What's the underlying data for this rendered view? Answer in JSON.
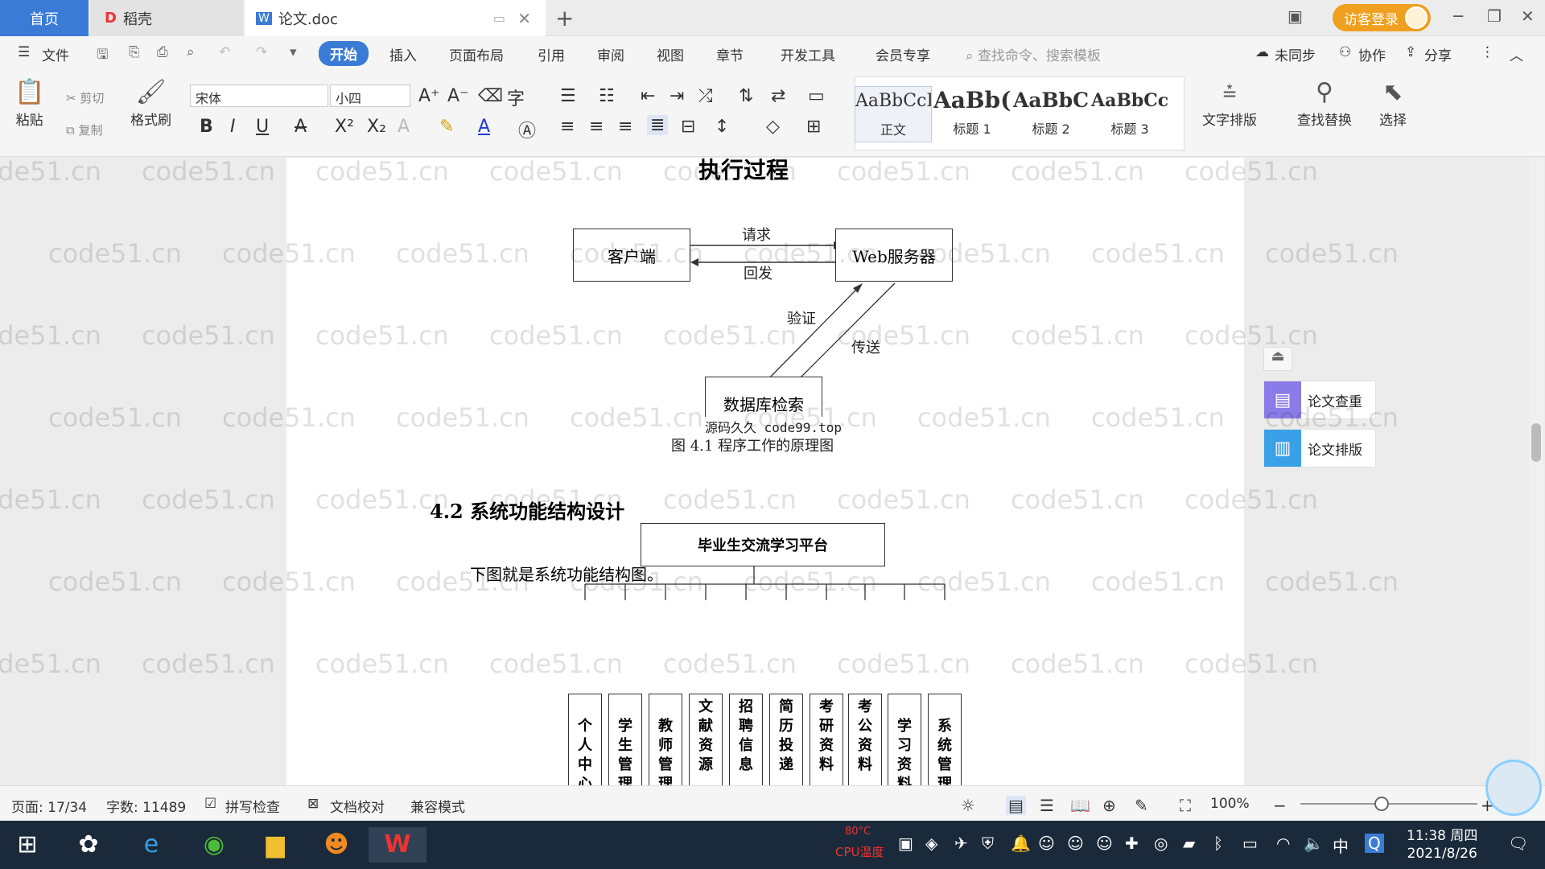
{
  "tabs": {
    "home": "首页",
    "daoke": "稻壳",
    "doc": "论文.doc",
    "add": "+"
  },
  "window": {
    "login": "访客登录",
    "min": "─",
    "restore": "❐",
    "close": "✕",
    "layout": "▣"
  },
  "menu": {
    "file": "文件",
    "start": "开始",
    "insert": "插入",
    "layout": "页面布局",
    "ref": "引用",
    "review": "审阅",
    "view": "视图",
    "chapter": "章节",
    "devtools": "开发工具",
    "member": "会员专享",
    "search": "查找命令、搜索模板",
    "unsync": "未同步",
    "collab": "协作",
    "share": "分享"
  },
  "ribbon": {
    "paste": "粘贴",
    "cut": "剪切",
    "copy": "复制",
    "format_painter": "格式刷",
    "font": "宋体",
    "size": "小四",
    "styles": [
      {
        "sample": "AaBbCcI",
        "name": "正文"
      },
      {
        "sample": "AaBb(",
        "name": "标题 1"
      },
      {
        "sample": "AaBbC",
        "name": "标题 2"
      },
      {
        "sample": "AaBbCcl",
        "name": "标题 3"
      }
    ],
    "text_layout": "文字排版",
    "find_replace": "查找替换",
    "select": "选择"
  },
  "doc": {
    "top_heading": "执行过程",
    "diagram1": {
      "client": "客户端",
      "web": "Web服务器",
      "request": "请求",
      "response": "回发",
      "verify": "验证",
      "transfer": "传送",
      "db": "数据库检索",
      "overlay": "源码久久 code99.top",
      "caption": "图 4.1  程序工作的原理图"
    },
    "section": "4.2 系统功能结构设计",
    "para": "下图就是系统功能结构图。",
    "diagram2": {
      "root": "毕业生交流学习平台",
      "children": [
        "个人中心",
        "学生管理",
        "教师管理",
        "文献资源",
        "招聘信息",
        "简历投递",
        "考研资料",
        "考公资料",
        "学习资料",
        "系统管理"
      ]
    }
  },
  "watermark": "code51.cn",
  "sidepanel": {
    "check": "论文查重",
    "typeset": "论文排版"
  },
  "status": {
    "page": "页面: 17/34",
    "words": "字数: 11489",
    "spell": "拼写检查",
    "proof": "文档校对",
    "compat": "兼容模式",
    "zoom": "100%"
  },
  "taskbar": {
    "time": "11:38 周四",
    "date": "2021/8/26",
    "ime": "中",
    "cpu": "CPU温度",
    "temp": "80°C"
  }
}
